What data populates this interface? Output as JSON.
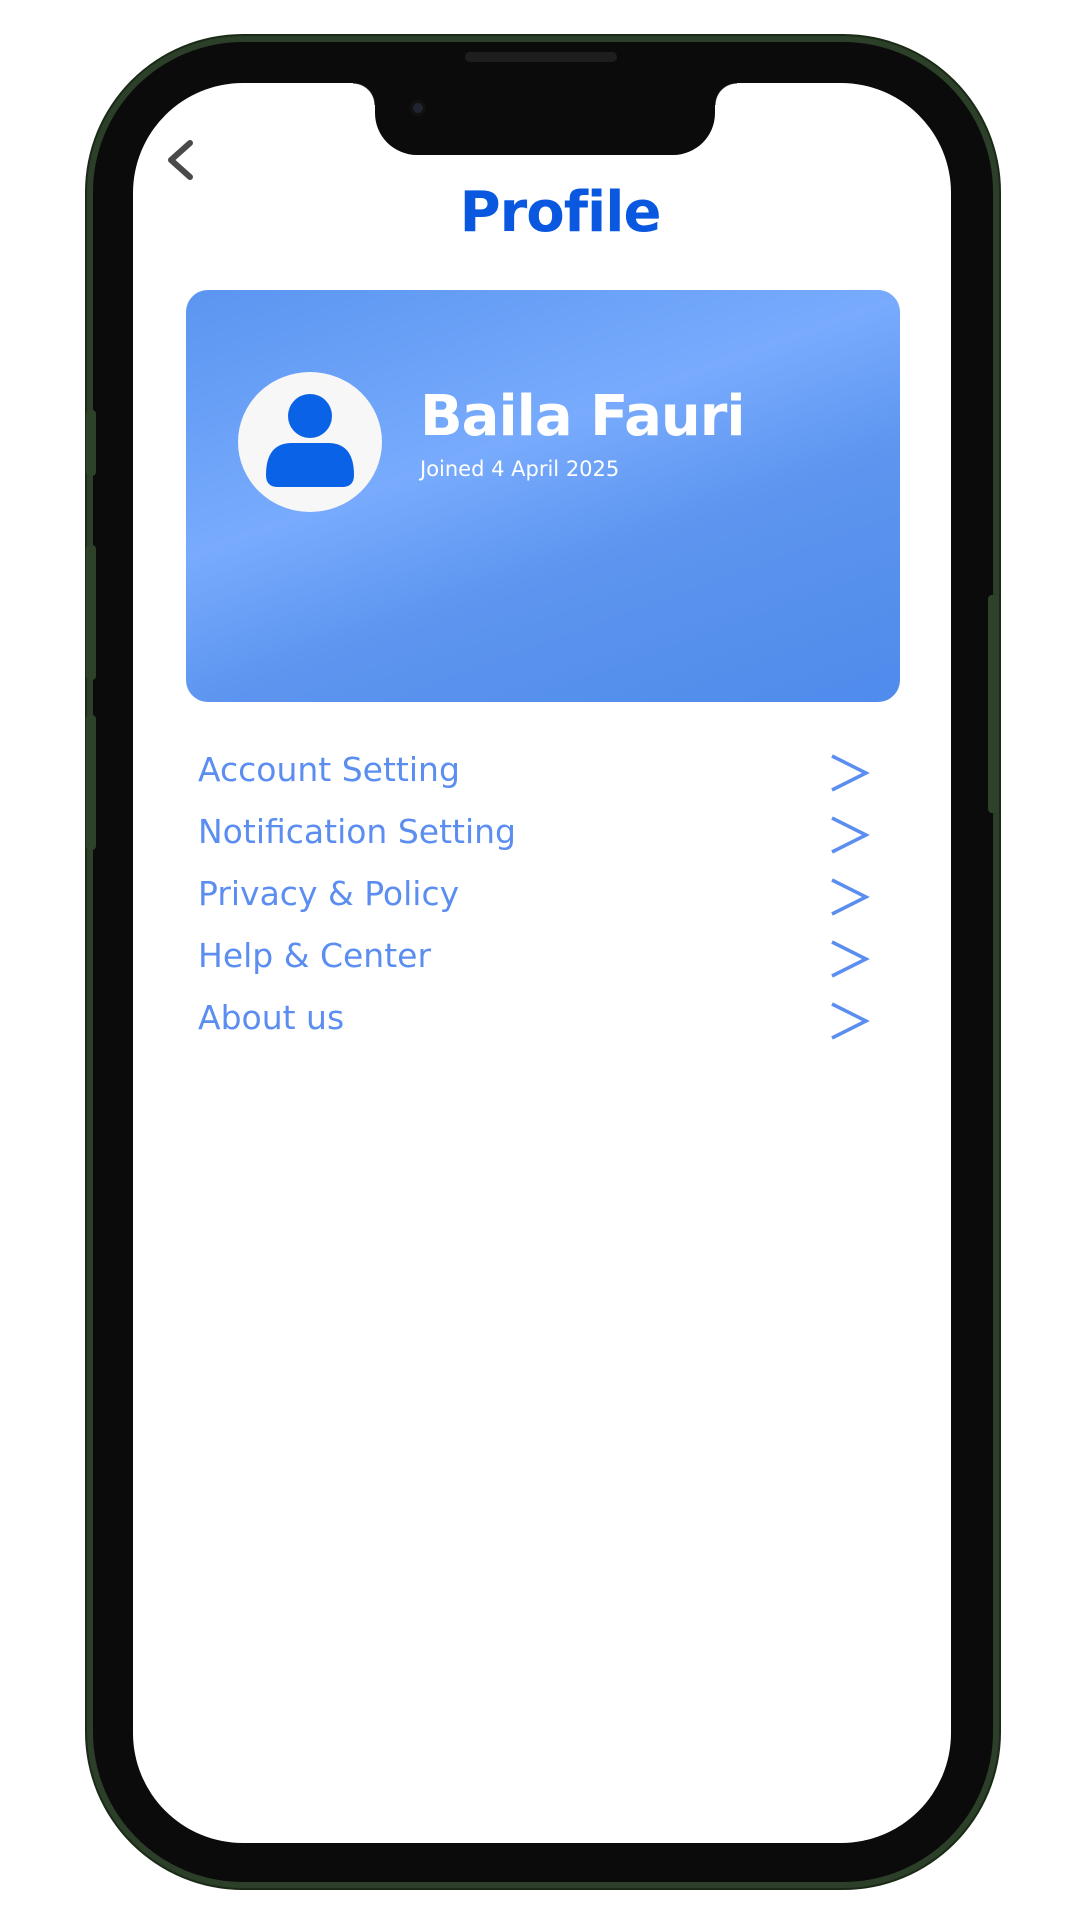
{
  "header": {
    "back_icon": "chevron-left-icon",
    "title": "Profile"
  },
  "profile": {
    "avatar_icon": "user-icon",
    "name": "Baila Fauri",
    "joined": "Joined 4 April 2025"
  },
  "menu": {
    "chevron_icon": "chevron-right-icon",
    "items": [
      {
        "label": "Account Setting"
      },
      {
        "label": "Notification Setting"
      },
      {
        "label": "Privacy & Policy"
      },
      {
        "label": "Help & Center"
      },
      {
        "label": "About us"
      }
    ]
  },
  "colors": {
    "accent": "#0a58e0",
    "menu_text": "#5b8ef0",
    "card_light": "#78abfd",
    "card_dark": "#4f8beb",
    "frame": "#2c3f28"
  }
}
